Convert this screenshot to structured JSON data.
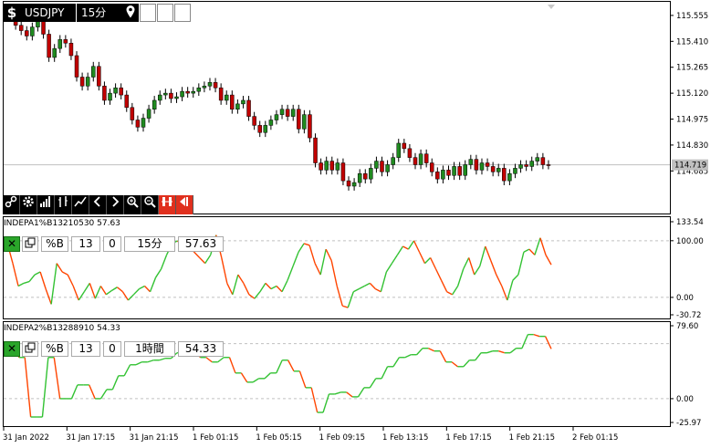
{
  "header": {
    "dollar_label": "$",
    "symbol": "USDJPY",
    "timeframe": "15分",
    "pin_icon": "map-pin-icon"
  },
  "toolbar": {
    "icons": [
      "link-icon",
      "gear-icon",
      "bar-signal-icon",
      "bars-up-icon",
      "trend-icon",
      "chevron-left-icon",
      "chevron-right-icon",
      "zoom-in-icon",
      "zoom-out-icon",
      "grid-red-icon",
      "back-red-icon"
    ],
    "colors": {
      "toolbar_bg": "#000000",
      "red_buttons": "#e0301e"
    }
  },
  "indicator1": {
    "title": "INDEPA1%B13210530 57.63",
    "controls": {
      "pct_label": "%B",
      "period": "13",
      "shift": "0",
      "timeframe": "15分",
      "value": "57.63"
    }
  },
  "indicator2": {
    "title": "INDEPA2%B13288910 54.33",
    "controls": {
      "pct_label": "%B",
      "period": "13",
      "shift": "0",
      "timeframe": "1時間",
      "value": "54.33"
    }
  },
  "chart_data": [
    {
      "type": "candlestick",
      "title": "USDJPY",
      "y_ticks": [
        "115.555",
        "115.410",
        "115.265",
        "115.120",
        "114.975",
        "114.830",
        "114.685"
      ],
      "ylim": [
        114.6,
        115.58
      ],
      "current_price": "114.719",
      "colors": {
        "up": "#1f8a1f",
        "down": "#c00000",
        "price_line": "#c0c0c0",
        "price_tag": "#c0c0c0"
      },
      "candles": [
        [
          115.56,
          115.55
        ],
        [
          115.55,
          115.5
        ],
        [
          115.5,
          115.47
        ],
        [
          115.47,
          115.44
        ],
        [
          115.44,
          115.49
        ],
        [
          115.49,
          115.52
        ],
        [
          115.52,
          115.45
        ],
        [
          115.45,
          115.32
        ],
        [
          115.32,
          115.37
        ],
        [
          115.37,
          115.42
        ],
        [
          115.42,
          115.4
        ],
        [
          115.4,
          115.33
        ],
        [
          115.33,
          115.21
        ],
        [
          115.21,
          115.16
        ],
        [
          115.16,
          115.21
        ],
        [
          115.21,
          115.27
        ],
        [
          115.27,
          115.16
        ],
        [
          115.16,
          115.08
        ],
        [
          115.08,
          115.12
        ],
        [
          115.12,
          115.15
        ],
        [
          115.15,
          115.11
        ],
        [
          115.11,
          115.04
        ],
        [
          115.04,
          114.97
        ],
        [
          114.97,
          114.93
        ],
        [
          114.93,
          114.98
        ],
        [
          114.98,
          115.03
        ],
        [
          115.03,
          115.08
        ],
        [
          115.08,
          115.11
        ],
        [
          115.11,
          115.12
        ],
        [
          115.12,
          115.09
        ],
        [
          115.09,
          115.1
        ],
        [
          115.1,
          115.13
        ],
        [
          115.13,
          115.12
        ],
        [
          115.12,
          115.13
        ],
        [
          115.13,
          115.15
        ],
        [
          115.15,
          115.16
        ],
        [
          115.16,
          115.18
        ],
        [
          115.18,
          115.15
        ],
        [
          115.15,
          115.08
        ],
        [
          115.08,
          115.11
        ],
        [
          115.11,
          115.03
        ],
        [
          115.03,
          115.06
        ],
        [
          115.06,
          115.08
        ],
        [
          115.08,
          114.99
        ],
        [
          114.99,
          114.94
        ],
        [
          114.94,
          114.9
        ],
        [
          114.9,
          114.94
        ],
        [
          114.94,
          114.97
        ],
        [
          114.97,
          115.0
        ],
        [
          115.0,
          115.03
        ],
        [
          115.03,
          114.99
        ],
        [
          114.99,
          115.03
        ],
        [
          115.03,
          114.92
        ],
        [
          114.92,
          115.0
        ],
        [
          115.0,
          114.87
        ],
        [
          114.87,
          114.73
        ],
        [
          114.73,
          114.69
        ],
        [
          114.69,
          114.74
        ],
        [
          114.74,
          114.69
        ],
        [
          114.69,
          114.73
        ],
        [
          114.73,
          114.63
        ],
        [
          114.63,
          114.6
        ],
        [
          114.6,
          114.62
        ],
        [
          114.62,
          114.67
        ],
        [
          114.67,
          114.64
        ],
        [
          114.64,
          114.7
        ],
        [
          114.7,
          114.74
        ],
        [
          114.74,
          114.68
        ],
        [
          114.68,
          114.72
        ],
        [
          114.72,
          114.76
        ],
        [
          114.76,
          114.84
        ],
        [
          114.84,
          114.81
        ],
        [
          114.81,
          114.76
        ],
        [
          114.76,
          114.72
        ],
        [
          114.72,
          114.78
        ],
        [
          114.78,
          114.73
        ],
        [
          114.73,
          114.68
        ],
        [
          114.68,
          114.64
        ],
        [
          114.64,
          114.69
        ],
        [
          114.69,
          114.66
        ],
        [
          114.66,
          114.71
        ],
        [
          114.71,
          114.66
        ],
        [
          114.66,
          114.72
        ],
        [
          114.72,
          114.75
        ],
        [
          114.75,
          114.69
        ],
        [
          114.69,
          114.73
        ],
        [
          114.73,
          114.71
        ],
        [
          114.71,
          114.68
        ],
        [
          114.68,
          114.7
        ],
        [
          114.7,
          114.63
        ],
        [
          114.63,
          114.67
        ],
        [
          114.67,
          114.7
        ],
        [
          114.7,
          114.72
        ],
        [
          114.72,
          114.71
        ],
        [
          114.71,
          114.74
        ],
        [
          114.74,
          114.76
        ],
        [
          114.76,
          114.72
        ],
        [
          114.72,
          114.719
        ]
      ]
    },
    {
      "type": "line",
      "title": "INDEPA1%B13210530 57.63",
      "y_ticks": [
        "133.54",
        "100.00",
        "0.00",
        "-30.72"
      ],
      "ylim": [
        -30.72,
        133.54
      ],
      "levels": [
        100,
        0
      ],
      "colors": {
        "up": "#33c233",
        "down": "#ff4500",
        "level_line": "#c0c0c0"
      },
      "values": [
        96,
        60,
        20,
        25,
        28,
        40,
        45,
        15,
        -12,
        60,
        45,
        40,
        20,
        -5,
        10,
        25,
        -2,
        20,
        5,
        12,
        18,
        10,
        -5,
        5,
        15,
        20,
        10,
        35,
        50,
        75,
        95,
        100,
        85,
        90,
        80,
        70,
        60,
        75,
        110,
        70,
        25,
        5,
        40,
        25,
        5,
        -2,
        10,
        25,
        15,
        20,
        10,
        30,
        55,
        80,
        95,
        92,
        60,
        40,
        85,
        65,
        20,
        -15,
        -18,
        10,
        15,
        20,
        25,
        15,
        10,
        45,
        60,
        75,
        90,
        85,
        100,
        80,
        60,
        70,
        50,
        30,
        10,
        5,
        20,
        50,
        70,
        40,
        55,
        90,
        65,
        40,
        20,
        -5,
        30,
        40,
        80,
        85,
        75,
        105,
        75,
        57.63
      ]
    },
    {
      "type": "line",
      "title": "INDEPA2%B13288910 54.33",
      "x_tick_labels": [
        "31 Jan 2022",
        "31 Jan 17:15",
        "31 Jan 21:15",
        "1 Feb 01:15",
        "1 Feb 05:15",
        "1 Feb 09:15",
        "1 Feb 13:15",
        "1 Feb 17:15",
        "1 Feb 21:15",
        "2 Feb 01:15"
      ],
      "y_ticks": [
        "79.60",
        "0.00",
        "-25.97"
      ],
      "ylim": [
        -25.97,
        79.6
      ],
      "levels": [
        60,
        0
      ],
      "colors": {
        "up": "#33c233",
        "down": "#ff4500",
        "level_line": "#c0c0c0"
      },
      "values": [
        60,
        60,
        45,
        45,
        -20,
        -20,
        -20,
        45,
        45,
        0,
        0,
        0,
        15,
        15,
        15,
        0,
        0,
        10,
        10,
        25,
        25,
        37,
        37,
        40,
        40,
        42,
        42,
        44,
        44,
        50,
        50,
        55,
        55,
        45,
        45,
        40,
        40,
        45,
        45,
        28,
        28,
        18,
        18,
        22,
        22,
        28,
        28,
        42,
        42,
        30,
        30,
        12,
        12,
        -15,
        -15,
        5,
        5,
        7,
        7,
        2,
        2,
        12,
        12,
        22,
        22,
        35,
        35,
        45,
        45,
        48,
        48,
        55,
        55,
        52,
        52,
        40,
        40,
        35,
        35,
        42,
        42,
        50,
        50,
        52,
        52,
        50,
        50,
        55,
        55,
        70,
        70,
        68,
        68,
        54.33
      ]
    }
  ]
}
